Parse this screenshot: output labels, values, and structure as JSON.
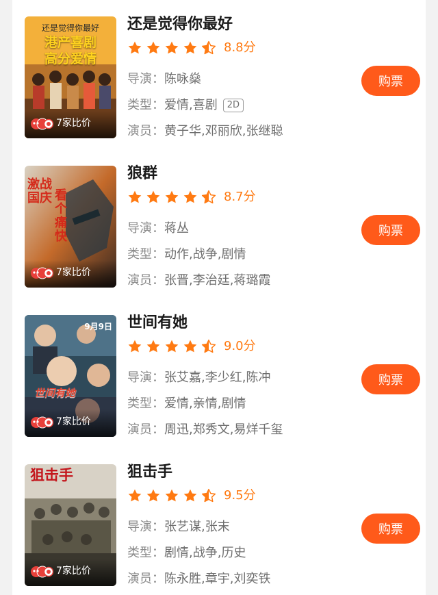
{
  "colors": {
    "accent": "#ff5a1a",
    "star": "#ff7a12",
    "text_primary": "#1a1a1a",
    "text_secondary": "#8a8a8a"
  },
  "labels": {
    "director": "导演：",
    "genre": "类型：",
    "cast": "演员：",
    "buy": "购票",
    "compare": "7家比价"
  },
  "movies": [
    {
      "title": "还是觉得你最好",
      "rating": 4.5,
      "score": "8.8分",
      "director": "陈咏燊",
      "genre": "爱情,喜剧",
      "format": "2D",
      "cast": "黄子华,邓丽欣,张继聪",
      "poster_text": [
        "还是觉得你最好",
        "港产喜剧",
        "高分爱情"
      ]
    },
    {
      "title": "狼群",
      "rating": 4.5,
      "score": "8.7分",
      "director": "蒋丛",
      "genre": "动作,战争,剧情",
      "cast": "张晋,李治廷,蒋璐霞",
      "poster_text": [
        "激战国庆",
        "看个痛快"
      ]
    },
    {
      "title": "世间有她",
      "rating": 4.5,
      "score": "9.0分",
      "director": "张艾嘉,李少红,陈冲",
      "genre": "爱情,亲情,剧情",
      "cast": "周迅,郑秀文,易烊千玺",
      "poster_text": [
        "9月9日",
        "世间有她"
      ]
    },
    {
      "title": "狙击手",
      "rating": 4.5,
      "score": "9.5分",
      "director": "张艺谋,张末",
      "genre": "剧情,战争,历史",
      "cast": "陈永胜,章宇,刘奕铁",
      "poster_text": [
        "狙击手"
      ]
    }
  ]
}
